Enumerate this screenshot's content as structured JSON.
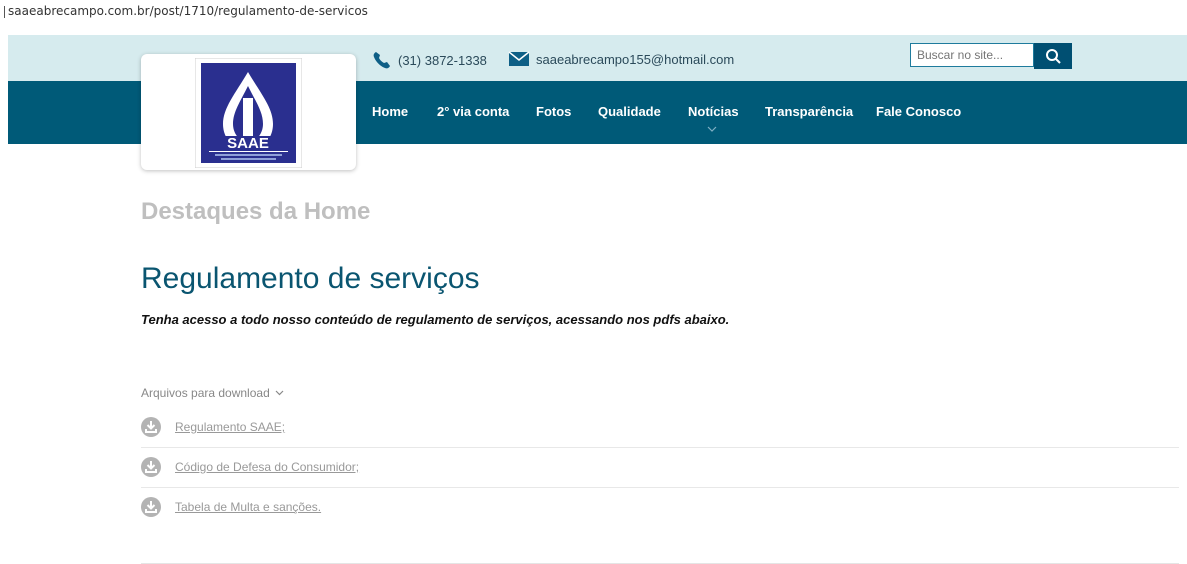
{
  "browser": {
    "url": "saaeabrecampo.com.br/post/1710/regulamento-de-servicos"
  },
  "header": {
    "phone": "(31) 3872-1338",
    "email": "saaeabrecampo155@hotmail.com",
    "search_placeholder": "Buscar no site...",
    "logo_text": "SAAE",
    "brand_colors": {
      "topbar": "#d6ebee",
      "navbar": "#005a78",
      "title": "#0a5570"
    }
  },
  "nav": {
    "items": [
      {
        "label": "Home"
      },
      {
        "label": "2° via conta"
      },
      {
        "label": "Fotos"
      },
      {
        "label": "Qualidade"
      },
      {
        "label": "Notícias"
      },
      {
        "label": "Transparência"
      },
      {
        "label": "Fale Conosco"
      }
    ]
  },
  "main": {
    "section_heading": "Destaques da Home",
    "title": "Regulamento de serviços",
    "subtitle": "Tenha acesso a todo nosso conteúdo de regulamento de serviços, acessando nos pdfs abaixo.",
    "downloads_label": "Arquivos para download",
    "downloads": [
      {
        "label": "Regulamento SAAE;"
      },
      {
        "label": "Código de Defesa do Consumidor;"
      },
      {
        "label": "Tabela de Multa e sanções."
      }
    ]
  }
}
